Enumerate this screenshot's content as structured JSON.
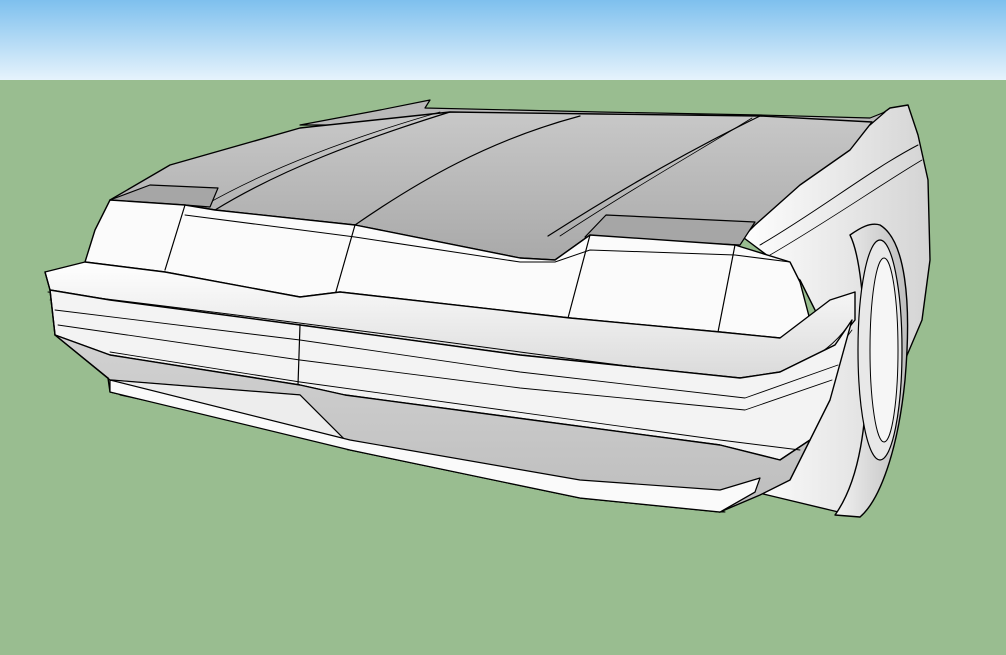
{
  "app": {
    "viewport_label": ""
  },
  "scene": {
    "model": "car-front-3d-model",
    "colors": {
      "sky_top": "#7EC0EE",
      "sky_bottom": "#E6F3FC",
      "ground": "#99BD90",
      "panel_light": "#FFFFFF",
      "panel_mid": "#E6E6E6",
      "panel_dark": "#C9C9C9",
      "edge": "#000000"
    }
  }
}
